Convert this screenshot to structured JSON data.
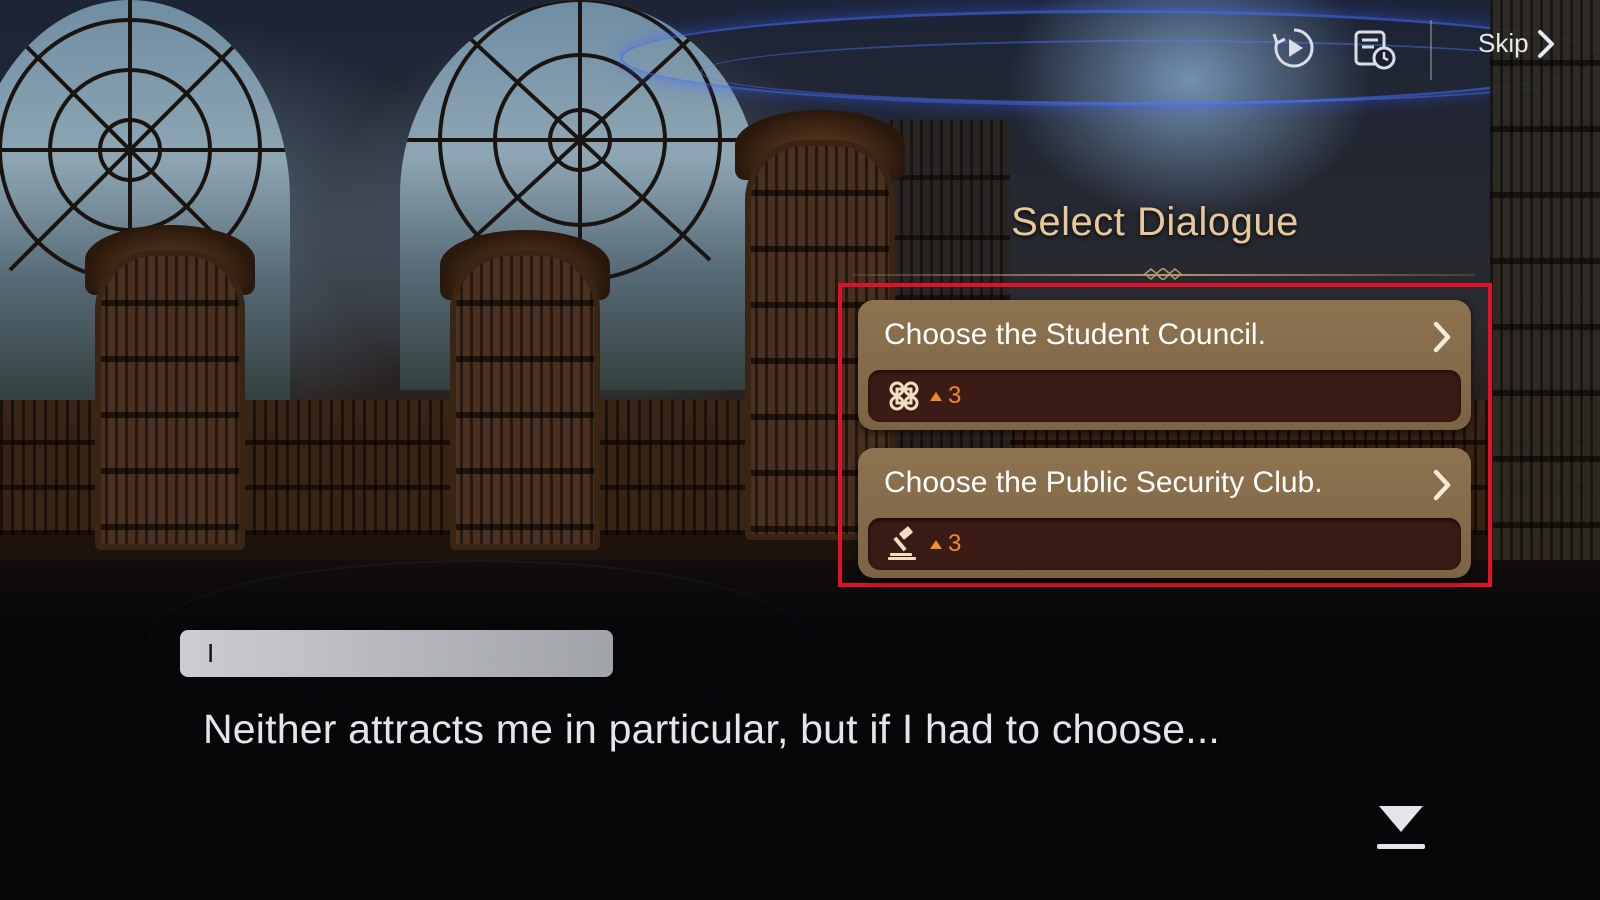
{
  "hud": {
    "auto_icon": "auto-play-icon",
    "log_icon": "dialogue-log-icon",
    "skip_label": "Skip"
  },
  "select_dialogue": {
    "title": "Select Dialogue",
    "options": [
      {
        "label": "Choose the Student Council.",
        "req_icon": "student-council-emblem-icon",
        "req_value": "3"
      },
      {
        "label": "Choose the Public Security Club.",
        "req_icon": "gavel-icon",
        "req_value": "3"
      }
    ]
  },
  "dialogue": {
    "speaker": "I",
    "text": "Neither attracts me in particular, but if I had to choose..."
  },
  "colors": {
    "title": "#e7c89a",
    "option_bg": "#8d7350",
    "requirement_bg": "#3b1b15",
    "requirement_accent": "#f08a2a",
    "highlight": "#e3102a"
  }
}
